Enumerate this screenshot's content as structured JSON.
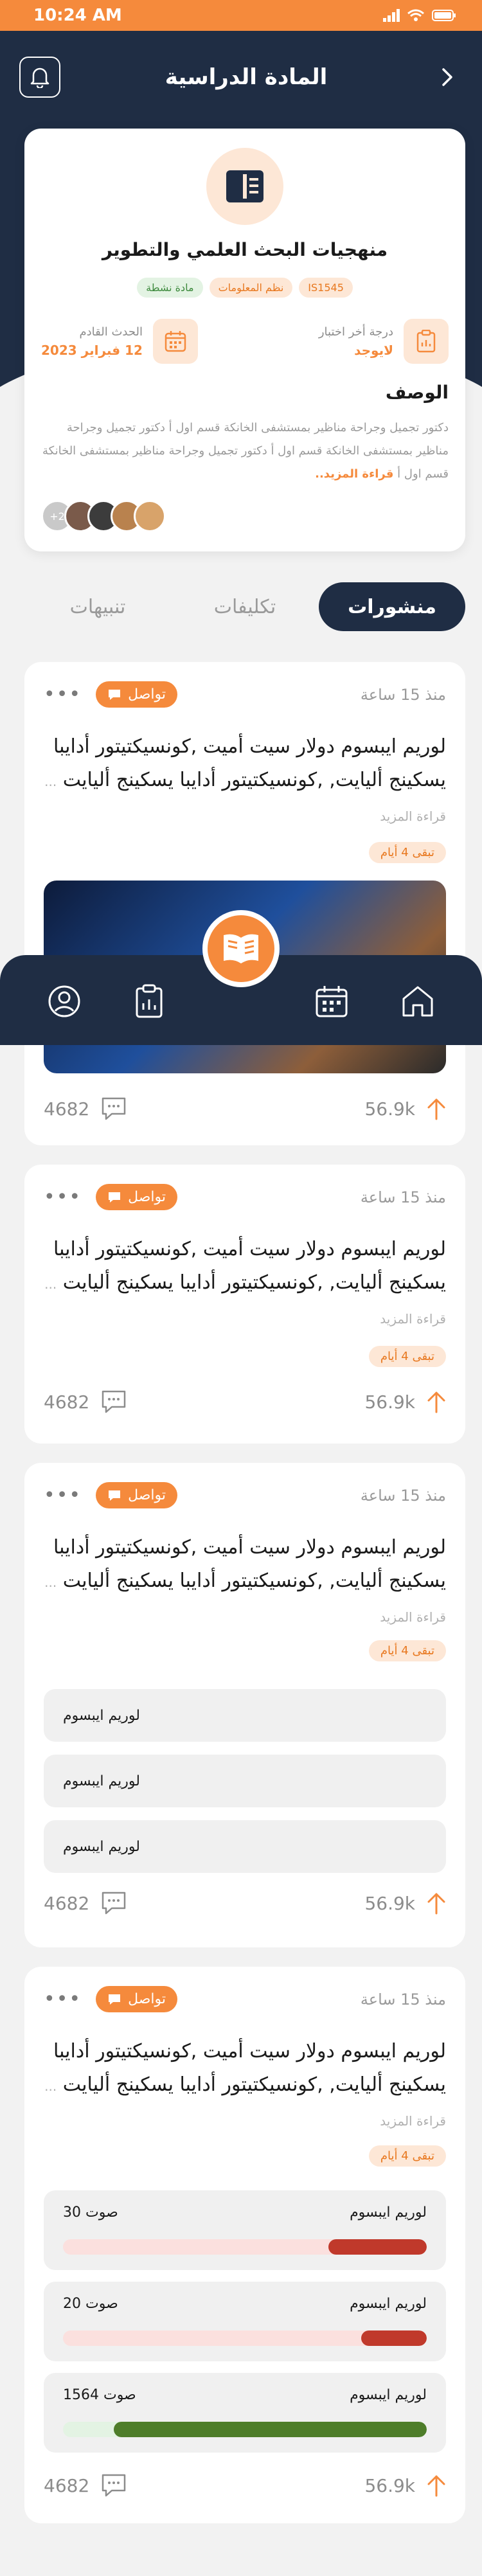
{
  "status": {
    "time": "10:24 AM"
  },
  "header": {
    "title": "المادة الدراسية"
  },
  "course": {
    "name": "منهجيات البحث العلمي والتطوير",
    "tags": [
      "IS1545",
      "نظم المعلومات",
      "مادة نشطة"
    ],
    "last_grade": {
      "label": "درجة أخر اختبار",
      "value": "لايوجد"
    },
    "next_event": {
      "label": "الحدث القادم",
      "value": "12 فبراير 2023"
    },
    "description_title": "الوصف",
    "description": "دكتور تجميل وجراحة مناظير بمستشفى الخانكة قسم اول أ دكتور تجميل وجراحة مناظير بمستشفى الخانكة قسم اول أ دكتور تجميل وجراحة مناظير بمستشفى الخانكة قسم اول أ",
    "read_more": "قراءة المزيد..",
    "extra_members": "+2"
  },
  "tabs": [
    "منشورات",
    "تكليفات",
    "تنبيهات"
  ],
  "post_common": {
    "time": "منذ 15 ساعة",
    "badge": "تواصل",
    "body": "لوريم ايبسوم دولار سيت أميت ,كونسيكتيتور أدايبا يسكينج أليايت, ,كونسيكتيتور أدايبا يسكينج أليايت",
    "read_more": "... قراءة المزيد",
    "remaining": "تبقى 4 أيام",
    "likes": "56.9k",
    "comments": "4682"
  },
  "options": [
    "لوريم ايبسوم",
    "لوريم ايبسوم",
    "لوريم ايبسوم"
  ],
  "poll": [
    {
      "label": "لوريم ايبسوم",
      "votes": "30 صوت",
      "fraction": 0.27,
      "color": "#c0392b"
    },
    {
      "label": "لوريم ايبسوم",
      "votes": "20 صوت",
      "fraction": 0.18,
      "color": "#c0392b"
    },
    {
      "label": "لوريم ايبسوم",
      "votes": "1564 صوت",
      "fraction": 0.86,
      "color": "#4e7d2a"
    }
  ],
  "colors": {
    "accent": "#f58a3c",
    "navy": "#1f2d44"
  }
}
